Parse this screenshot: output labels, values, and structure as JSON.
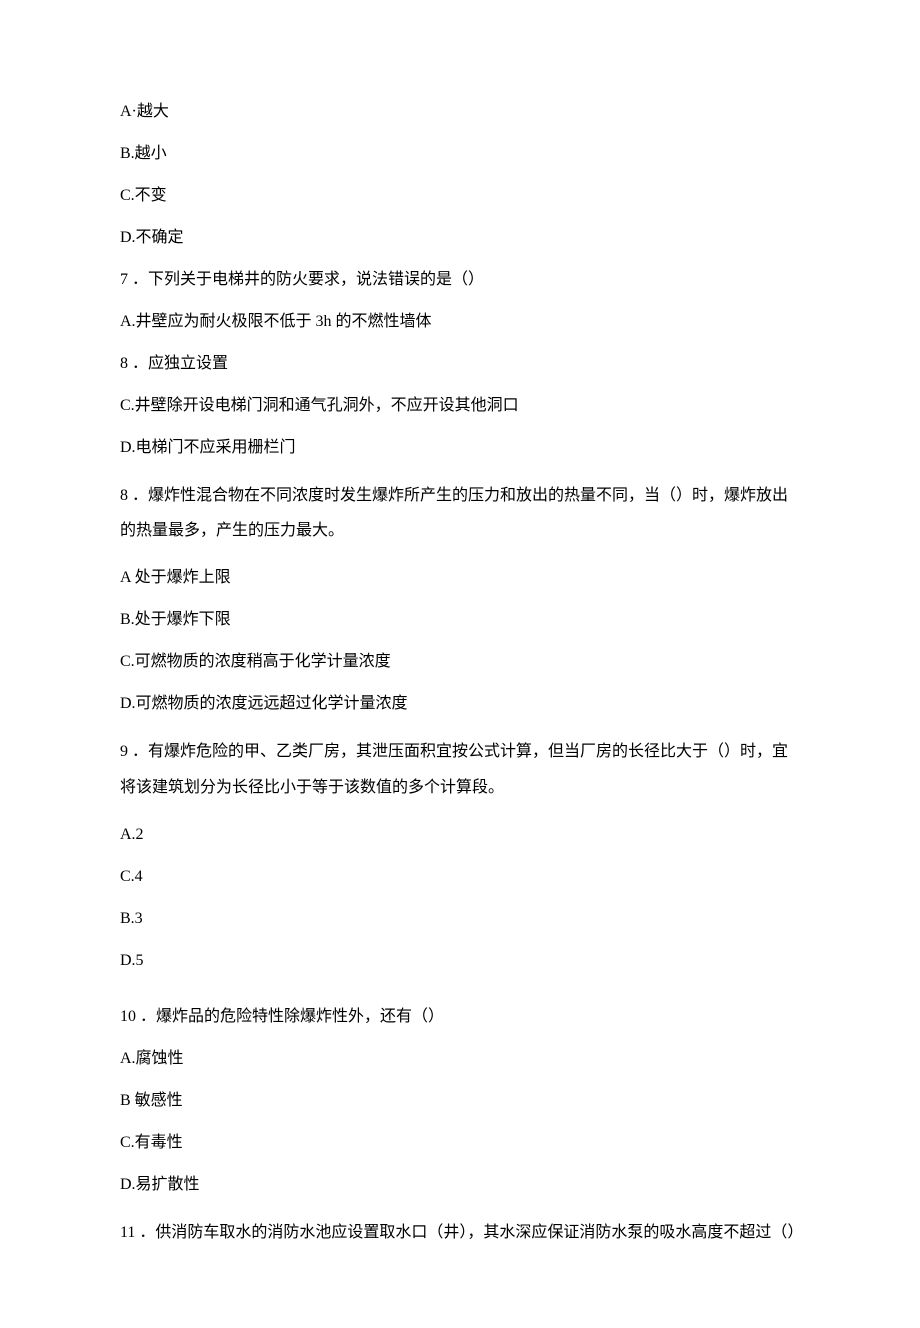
{
  "lines": {
    "a6": "A·越大",
    "b6": "B.越小",
    "c6": "C.不变",
    "d6": "D.不确定",
    "q7": "7 ．下列关于电梯井的防火要求，说法错误的是（）",
    "a7": "A.井壁应为耐火极限不低于 3h 的不燃性墙体",
    "b7line": "8 ．应独立设置",
    "c7": "C.井壁除开设电梯门洞和通气孔洞外，不应开设其他洞口",
    "d7": "D.电梯门不应采用栅栏门",
    "q8": "8 ．爆炸性混合物在不同浓度时发生爆炸所产生的压力和放出的热量不同，当（）时，爆炸放出的热量最多，产生的压力最大。",
    "a8": "A 处于爆炸上限",
    "b8": "B.处于爆炸下限",
    "c8": "C.可燃物质的浓度稍高于化学计量浓度",
    "d8": "D.可燃物质的浓度远远超过化学计量浓度",
    "q9": "9 ．有爆炸危险的甲、乙类厂房，其泄压面积宜按公式计算，但当厂房的长径比大于（）时，宜将该建筑划分为长径比小于等于该数值的多个计算段。",
    "a9": "A.2",
    "c9": "C.4",
    "b9": "B.3",
    "d9": "D.5",
    "q10": "10 ．爆炸品的危险特性除爆炸性外，还有（）",
    "a10": "A.腐蚀性",
    "b10": "B 敏感性",
    "c10": "C.有毒性",
    "d10": "D.易扩散性",
    "q11": "11 ．供消防车取水的消防水池应设置取水口（井），其水深应保证消防水泵的吸水高度不超过（）"
  }
}
